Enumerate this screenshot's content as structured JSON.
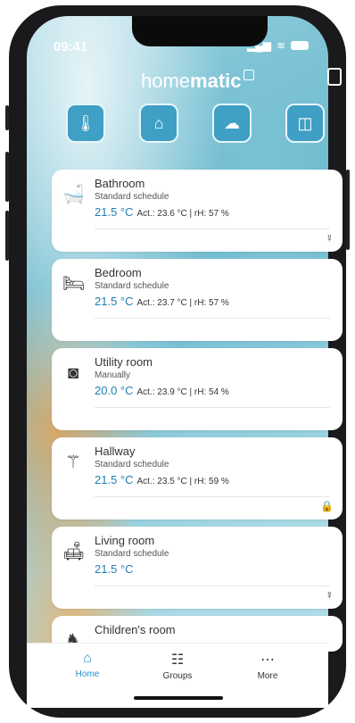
{
  "status": {
    "time": "09:41"
  },
  "app": {
    "logo_prefix": "home",
    "logo_bold": "matic"
  },
  "categories": [
    {
      "icon": "thermometer-icon",
      "glyph": "🌡"
    },
    {
      "icon": "house-icon",
      "glyph": "⌂"
    },
    {
      "icon": "cloud-icon",
      "glyph": "☁"
    },
    {
      "icon": "window-icon",
      "glyph": "◫"
    }
  ],
  "rooms": [
    {
      "name": "Bathroom",
      "mode": "Standard schedule",
      "temp": "21.5 °C",
      "details": "Act.: 23.6 °C  |  rH: 57 %",
      "icon": "bathtub-icon",
      "glyph": "🛁",
      "badge": "☿",
      "badge_icon": "vent-icon"
    },
    {
      "name": "Bedroom",
      "mode": "Standard schedule",
      "temp": "21.5 °C",
      "details": "Act.: 23.7 °C  |  rH: 57 %",
      "icon": "bed-icon",
      "glyph": "🛏",
      "badge": "",
      "badge_icon": ""
    },
    {
      "name": "Utility room",
      "mode": "Manually",
      "temp": "20.0 °C",
      "details": "Act.: 23.9 °C  |  rH: 54 %",
      "icon": "washing-machine-icon",
      "glyph": "◙",
      "badge": "",
      "badge_icon": ""
    },
    {
      "name": "Hallway",
      "mode": "Standard schedule",
      "temp": "21.5 °C",
      "details": "Act.: 23.5 °C  |  rH: 59 %",
      "icon": "coat-rack-icon",
      "glyph": "⚚",
      "badge": "🔒",
      "badge_icon": "lock-icon"
    },
    {
      "name": "Living room",
      "mode": "Standard schedule",
      "temp": "21.5 °C",
      "details": "",
      "icon": "sofa-icon",
      "glyph": "🛋",
      "badge": "☿",
      "badge_icon": "vent-icon"
    },
    {
      "name": "Children's room",
      "mode": "",
      "temp": "",
      "details": "",
      "icon": "rocking-horse-icon",
      "glyph": "♞",
      "badge": "",
      "badge_icon": ""
    }
  ],
  "tabs": [
    {
      "label": "Home",
      "icon": "home-icon",
      "glyph": "⌂"
    },
    {
      "label": "Groups",
      "icon": "groups-icon",
      "glyph": "☷"
    },
    {
      "label": "More",
      "icon": "more-icon",
      "glyph": "⋯"
    }
  ]
}
